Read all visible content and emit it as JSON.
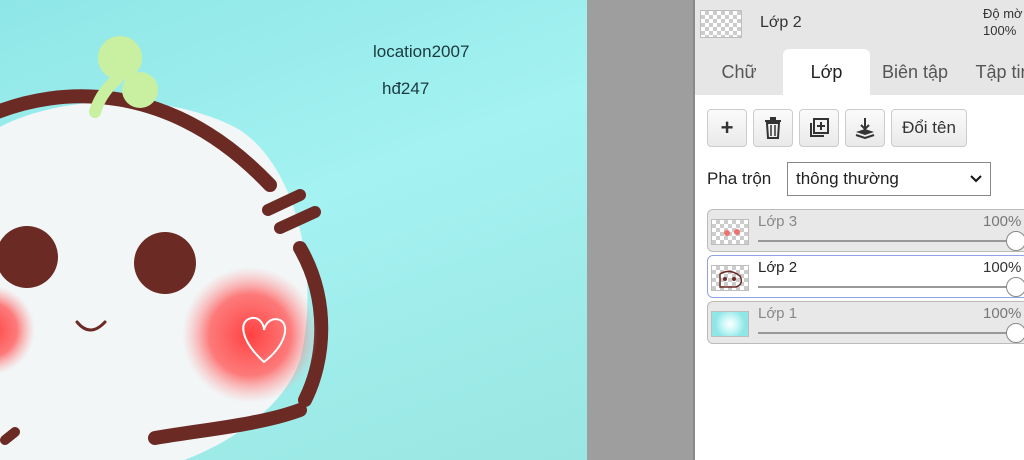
{
  "canvas": {
    "texts": [
      "location2007",
      "hđ247"
    ]
  },
  "panel": {
    "header": {
      "layer_name": "Lớp 2",
      "opacity_label": "Độ mờ",
      "opacity_value": "100%"
    },
    "tabs": [
      {
        "label": "Chữ",
        "active": false
      },
      {
        "label": "Lớp",
        "active": true
      },
      {
        "label": "Biên tập",
        "active": false
      },
      {
        "label": "Tập tin",
        "active": false
      }
    ],
    "toolbar": {
      "add_label": "+",
      "delete_icon": "trash-icon",
      "duplicate_icon": "duplicate-icon",
      "merge_icon": "merge-down-icon",
      "rename_label": "Đổi tên"
    },
    "blend": {
      "label": "Pha trộn",
      "selected": "thông thường"
    },
    "layers": [
      {
        "name": "Lớp 3",
        "opacity": "100%",
        "selected": false
      },
      {
        "name": "Lớp 2",
        "opacity": "100%",
        "selected": true
      },
      {
        "name": "Lớp 1",
        "opacity": "100%",
        "selected": false
      }
    ]
  },
  "colors": {
    "canvas_bg": "#9ff0f0",
    "panel_bg": "#e6e6e6",
    "selected_border": "#8fa4e8",
    "character_outline": "#6b2a24",
    "blush": "#ff5a5a",
    "sprout": "#c8f0a0"
  }
}
